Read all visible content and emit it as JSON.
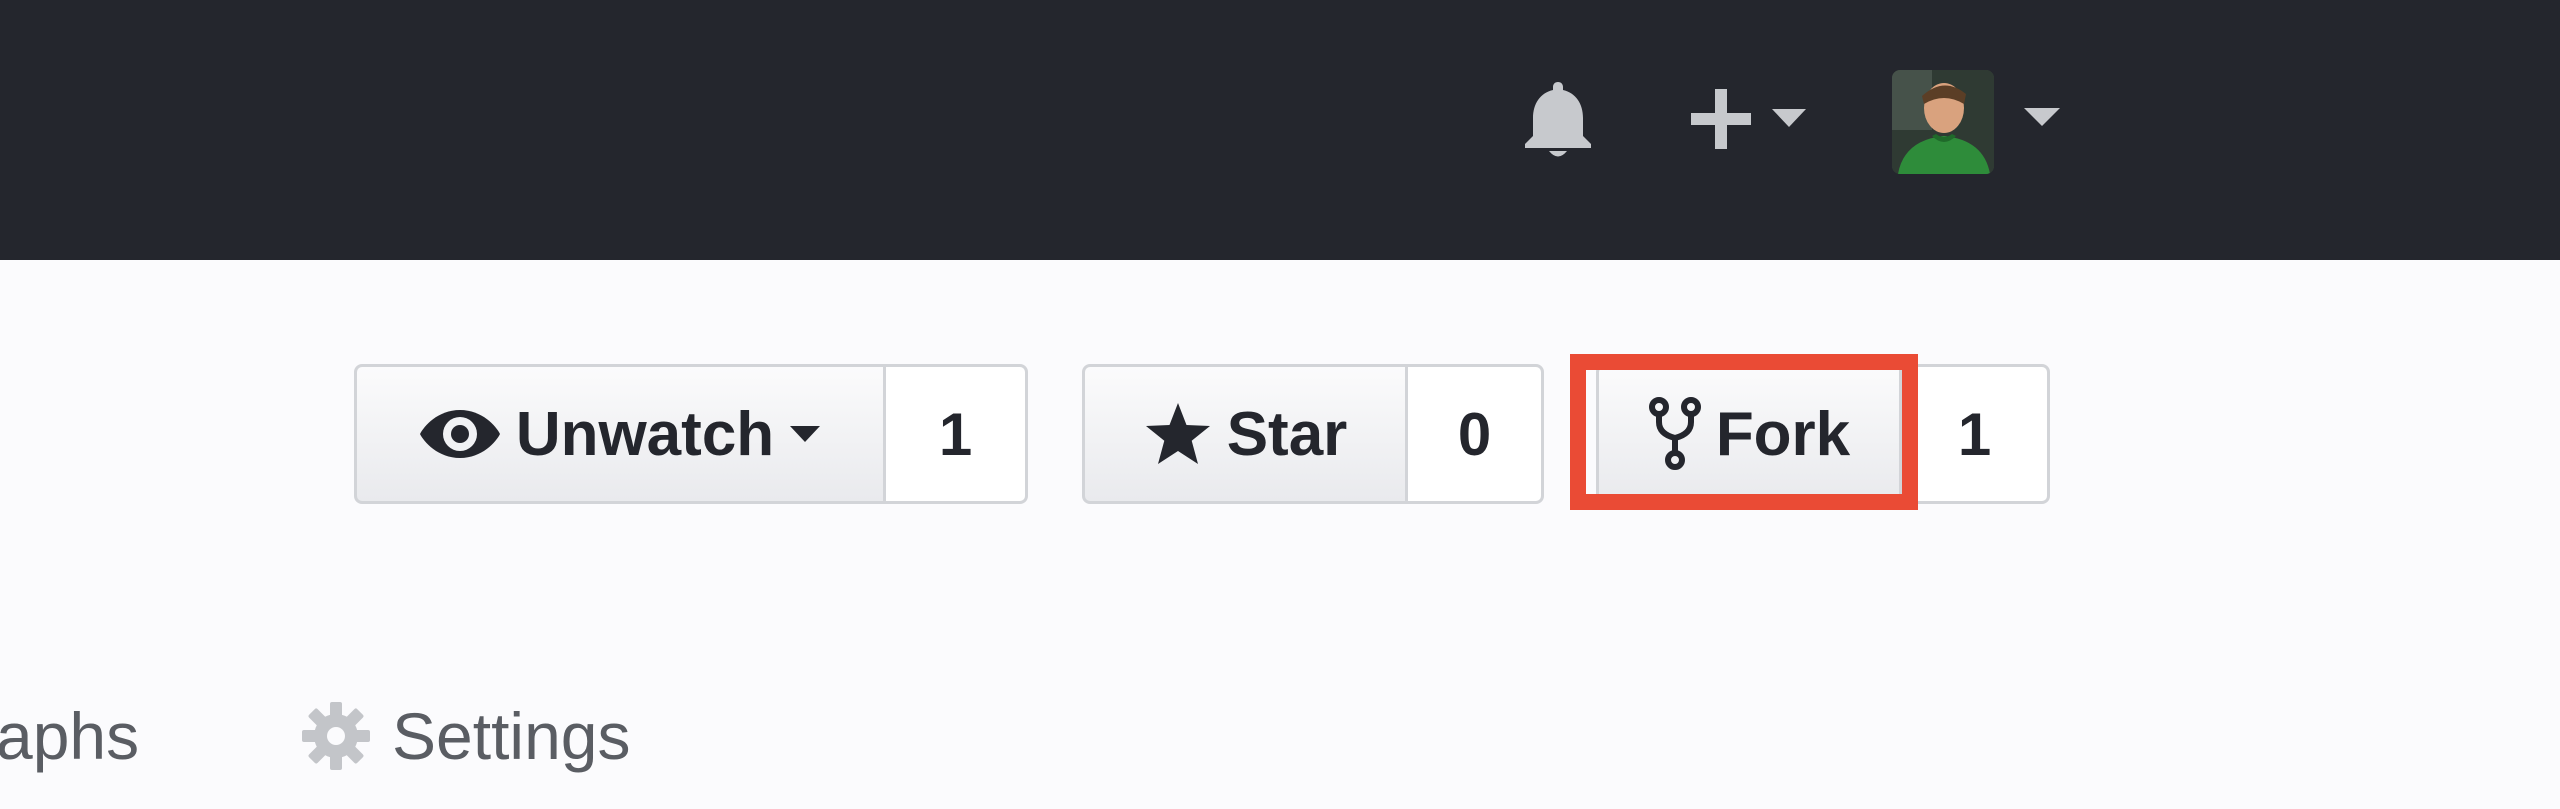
{
  "header": {
    "icons": {
      "notifications": "bell-icon",
      "create_new": "plus-icon",
      "create_caret": "caret-down-icon",
      "user_menu_caret": "caret-down-icon"
    },
    "background_color": "#24262d"
  },
  "pagehead_actions": {
    "watch": {
      "label": "Unwatch",
      "count": "1",
      "icon": "eye-icon"
    },
    "star": {
      "label": "Star",
      "count": "0",
      "icon": "star-icon"
    },
    "fork": {
      "label": "Fork",
      "count": "1",
      "icon": "repo-forked-icon"
    },
    "highlight_color": "#ea4b35"
  },
  "repo_nav": {
    "graphs_label": "aphs",
    "settings_label": "Settings",
    "settings_icon": "gear-icon"
  }
}
